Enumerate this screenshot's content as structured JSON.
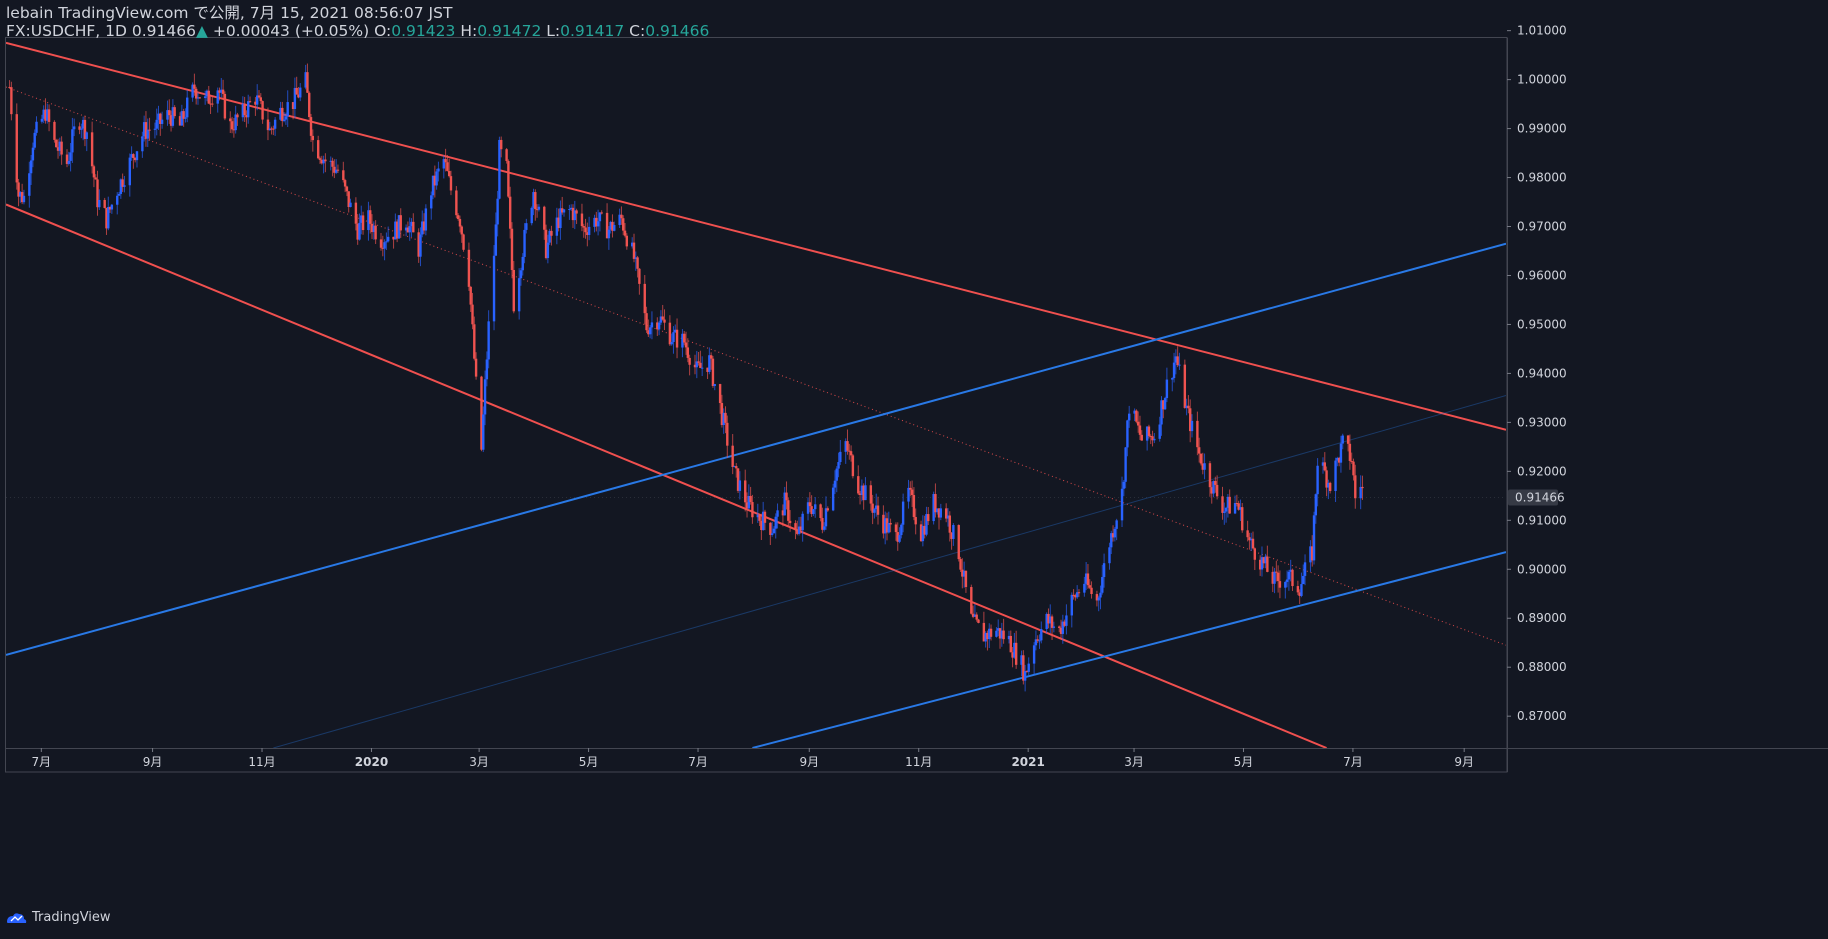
{
  "header": {
    "publish_line": "lebain TradingView.com で公開, 7月 15, 2021 08:56:07 JST",
    "symbol": "FX:USDCHF, 1D",
    "last": "0.91466",
    "change": "+0.00043 (+0.05%)",
    "o_label": "O:",
    "o_value": "0.91423",
    "h_label": "H:",
    "h_value": "0.91472",
    "l_label": "L:",
    "l_value": "0.91417",
    "c_label": "C:",
    "c_value": "0.91466",
    "up_arrow": "▲"
  },
  "footer": {
    "brand": "TradingView",
    "logo_icon": "tradingview-logo-icon"
  },
  "colors": {
    "background": "#131722",
    "up_candle": "#2962ff",
    "down_candle": "#ef5350",
    "channel_red": "#f0504f",
    "channel_blue": "#2979e6",
    "text": "#d1d4dc",
    "price_label_bg": "#363a45"
  },
  "chart_data": {
    "type": "candlestick",
    "symbol": "FX:USDCHF",
    "timeframe": "1D",
    "x_axis": {
      "tick_labels": [
        "7月",
        "9月",
        "11月",
        "2020",
        "3月",
        "5月",
        "7月",
        "9月",
        "11月",
        "2021",
        "3月",
        "5月",
        "7月",
        "9月"
      ],
      "bold_labels": [
        "2020",
        "2021"
      ],
      "range": [
        "2019-06-18",
        "2021-10-01"
      ]
    },
    "y_axis": {
      "tick_labels": [
        "1.01000",
        "1.00000",
        "0.99000",
        "0.98000",
        "0.97000",
        "0.96000",
        "0.95000",
        "0.94000",
        "0.93000",
        "0.92000",
        "0.91000",
        "0.90000",
        "0.89000",
        "0.88000",
        "0.87000"
      ],
      "range": [
        0.8635,
        1.0085
      ],
      "last_price_label": "0.91466",
      "last_price": 0.91466
    },
    "series": [
      {
        "type": "ohlc_close_path",
        "approximate": true,
        "points": [
          [
            "2019-06-20",
            0.9985
          ],
          [
            "2019-06-25",
            0.9765
          ],
          [
            "2019-06-28",
            0.976
          ],
          [
            "2019-07-03",
            0.9875
          ],
          [
            "2019-07-10",
            0.9935
          ],
          [
            "2019-07-15",
            0.987
          ],
          [
            "2019-07-22",
            0.983
          ],
          [
            "2019-07-28",
            0.9925
          ],
          [
            "2019-08-02",
            0.9895
          ],
          [
            "2019-08-08",
            0.9755
          ],
          [
            "2019-08-13",
            0.9715
          ],
          [
            "2019-08-19",
            0.9775
          ],
          [
            "2019-08-26",
            0.983
          ],
          [
            "2019-09-03",
            0.9895
          ],
          [
            "2019-09-10",
            0.9905
          ],
          [
            "2019-09-17",
            0.993
          ],
          [
            "2019-09-23",
            0.9905
          ],
          [
            "2019-10-01",
            0.9985
          ],
          [
            "2019-10-07",
            0.9955
          ],
          [
            "2019-10-14",
            0.9985
          ],
          [
            "2019-10-21",
            0.9905
          ],
          [
            "2019-10-28",
            0.993
          ],
          [
            "2019-11-04",
            0.9965
          ],
          [
            "2019-11-12",
            0.9895
          ],
          [
            "2019-11-18",
            0.9935
          ],
          [
            "2019-11-25",
            0.9955
          ],
          [
            "2019-12-02",
            0.9995
          ],
          [
            "2019-12-06",
            0.9875
          ],
          [
            "2019-12-13",
            0.9835
          ],
          [
            "2019-12-20",
            0.9815
          ],
          [
            "2019-12-31",
            0.9695
          ],
          [
            "2020-01-06",
            0.9715
          ],
          [
            "2020-01-13",
            0.9675
          ],
          [
            "2020-01-20",
            0.969
          ],
          [
            "2020-01-27",
            0.9715
          ],
          [
            "2020-02-03",
            0.9655
          ],
          [
            "2020-02-10",
            0.9775
          ],
          [
            "2020-02-17",
            0.9835
          ],
          [
            "2020-02-21",
            0.9775
          ],
          [
            "2020-02-26",
            0.9715
          ],
          [
            "2020-03-02",
            0.9595
          ],
          [
            "2020-03-06",
            0.9375
          ],
          [
            "2020-03-09",
            0.9245
          ],
          [
            "2020-03-11",
            0.9375
          ],
          [
            "2020-03-13",
            0.9495
          ],
          [
            "2020-03-17",
            0.9695
          ],
          [
            "2020-03-19",
            0.9855
          ],
          [
            "2020-03-23",
            0.9815
          ],
          [
            "2020-03-27",
            0.9545
          ],
          [
            "2020-04-01",
            0.9655
          ],
          [
            "2020-04-07",
            0.9775
          ],
          [
            "2020-04-14",
            0.9655
          ],
          [
            "2020-04-21",
            0.9715
          ],
          [
            "2020-04-28",
            0.9735
          ],
          [
            "2020-05-05",
            0.9695
          ],
          [
            "2020-05-12",
            0.9715
          ],
          [
            "2020-05-19",
            0.9695
          ],
          [
            "2020-05-26",
            0.9715
          ],
          [
            "2020-06-02",
            0.9635
          ],
          [
            "2020-06-09",
            0.9495
          ],
          [
            "2020-06-16",
            0.9515
          ],
          [
            "2020-06-23",
            0.9475
          ],
          [
            "2020-06-30",
            0.9465
          ],
          [
            "2020-07-07",
            0.9405
          ],
          [
            "2020-07-14",
            0.9425
          ],
          [
            "2020-07-21",
            0.9315
          ],
          [
            "2020-07-28",
            0.9195
          ],
          [
            "2020-08-04",
            0.9135
          ],
          [
            "2020-08-11",
            0.9105
          ],
          [
            "2020-08-18",
            0.9085
          ],
          [
            "2020-08-25",
            0.9135
          ],
          [
            "2020-09-01",
            0.9065
          ],
          [
            "2020-09-08",
            0.9135
          ],
          [
            "2020-09-15",
            0.9095
          ],
          [
            "2020-09-22",
            0.9195
          ],
          [
            "2020-09-28",
            0.9255
          ],
          [
            "2020-10-05",
            0.9175
          ],
          [
            "2020-10-12",
            0.9135
          ],
          [
            "2020-10-19",
            0.9095
          ],
          [
            "2020-10-26",
            0.9065
          ],
          [
            "2020-11-02",
            0.9155
          ],
          [
            "2020-11-09",
            0.9075
          ],
          [
            "2020-11-16",
            0.9135
          ],
          [
            "2020-11-23",
            0.9115
          ],
          [
            "2020-11-30",
            0.9035
          ],
          [
            "2020-12-07",
            0.8895
          ],
          [
            "2020-12-14",
            0.8865
          ],
          [
            "2020-12-21",
            0.8875
          ],
          [
            "2020-12-28",
            0.8855
          ],
          [
            "2021-01-04",
            0.8805
          ],
          [
            "2021-01-06",
            0.8785
          ],
          [
            "2021-01-11",
            0.8855
          ],
          [
            "2021-01-18",
            0.8895
          ],
          [
            "2021-01-25",
            0.8875
          ],
          [
            "2021-02-01",
            0.8935
          ],
          [
            "2021-02-08",
            0.8975
          ],
          [
            "2021-02-15",
            0.8935
          ],
          [
            "2021-02-22",
            0.9055
          ],
          [
            "2021-03-01",
            0.9155
          ],
          [
            "2021-03-05",
            0.9335
          ],
          [
            "2021-03-12",
            0.9265
          ],
          [
            "2021-03-19",
            0.9275
          ],
          [
            "2021-03-26",
            0.9375
          ],
          [
            "2021-03-31",
            0.9435
          ],
          [
            "2021-04-06",
            0.9325
          ],
          [
            "2021-04-13",
            0.9235
          ],
          [
            "2021-04-20",
            0.9175
          ],
          [
            "2021-04-27",
            0.9125
          ],
          [
            "2021-05-04",
            0.9135
          ],
          [
            "2021-05-11",
            0.9055
          ],
          [
            "2021-05-18",
            0.9015
          ],
          [
            "2021-05-25",
            0.8975
          ],
          [
            "2021-06-01",
            0.8985
          ],
          [
            "2021-06-08",
            0.8965
          ],
          [
            "2021-06-15",
            0.9035
          ],
          [
            "2021-06-18",
            0.9225
          ],
          [
            "2021-06-25",
            0.9175
          ],
          [
            "2021-07-02",
            0.9255
          ],
          [
            "2021-07-07",
            0.9225
          ],
          [
            "2021-07-09",
            0.9145
          ],
          [
            "2021-07-12",
            0.9175
          ],
          [
            "2021-07-14",
            0.91466
          ]
        ]
      }
    ],
    "drawings": [
      {
        "name": "red-channel-upper",
        "color": "#f0504f",
        "from": [
          "2019-06-18",
          1.0075
        ],
        "to": [
          "2021-10-01",
          0.9285
        ]
      },
      {
        "name": "red-channel-lower",
        "color": "#f0504f",
        "from": [
          "2019-06-18",
          0.9745
        ],
        "to": [
          "2021-06-23",
          0.8635
        ]
      },
      {
        "name": "red-channel-mid",
        "color": "#f0504f",
        "style": "dotted",
        "from": [
          "2019-06-18",
          0.9985
        ],
        "to": [
          "2021-10-01",
          0.8845
        ]
      },
      {
        "name": "blue-channel-upper",
        "color": "#2979e6",
        "from": [
          "2019-06-18",
          0.8825
        ],
        "to": [
          "2021-10-01",
          0.9665
        ]
      },
      {
        "name": "blue-channel-lower",
        "color": "#2979e6",
        "from": [
          "2020-08-07",
          0.8635
        ],
        "to": [
          "2021-10-01",
          0.9035
        ]
      },
      {
        "name": "blue-channel-mid",
        "color": "#2979e6",
        "style": "faint",
        "from": [
          "2019-11-14",
          0.8635
        ],
        "to": [
          "2021-10-01",
          0.9355
        ]
      }
    ]
  }
}
